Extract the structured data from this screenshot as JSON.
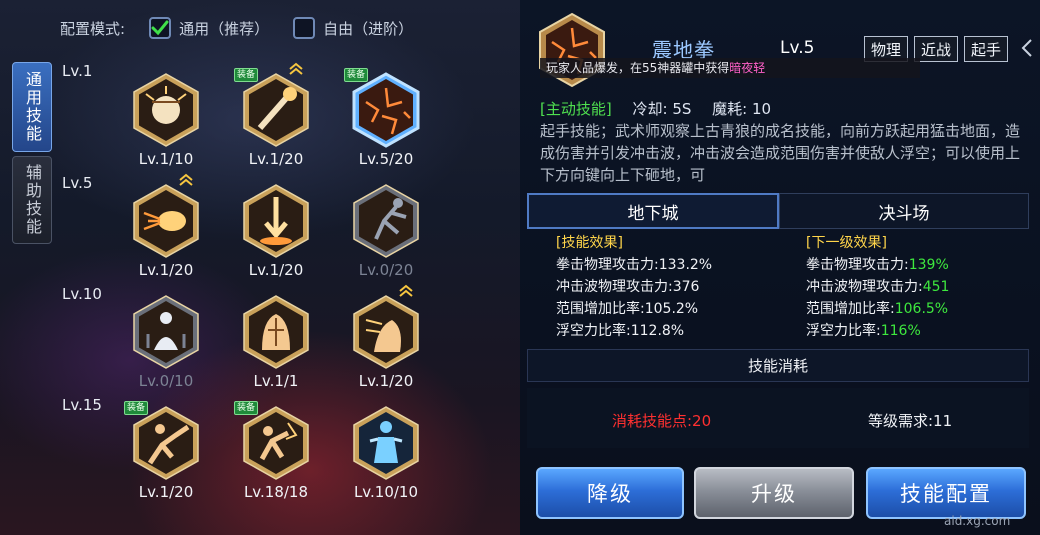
{
  "config": {
    "label": "配置模式:",
    "option_general": "通用（推荐）",
    "option_free": "自由（进阶）",
    "general_checked": true
  },
  "tabs": {
    "general": "通用技能",
    "support": "辅助技能"
  },
  "levels": [
    "Lv.1",
    "Lv.5",
    "Lv.10",
    "Lv.15"
  ],
  "skills": [
    {
      "level_text": "Lv.1/10",
      "icon": "fist-icon",
      "equipped": false,
      "upgradeable": false,
      "dim": false
    },
    {
      "level_text": "Lv.1/20",
      "icon": "hammer-punch-icon",
      "equipped": true,
      "upgradeable": true,
      "dim": false
    },
    {
      "level_text": "Lv.5/20",
      "icon": "earthquake-fist-icon",
      "equipped": true,
      "upgradeable": false,
      "dim": false
    },
    {
      "level_text": "Lv.1/20",
      "icon": "fireball-punch-icon",
      "equipped": false,
      "upgradeable": true,
      "dim": false
    },
    {
      "level_text": "Lv.1/20",
      "icon": "downward-strike-icon",
      "equipped": false,
      "upgradeable": false,
      "dim": false
    },
    {
      "level_text": "Lv.0/20",
      "icon": "fighter-stance-icon",
      "equipped": false,
      "upgradeable": false,
      "dim": true
    },
    {
      "level_text": "Lv.0/10",
      "icon": "meditation-icon",
      "equipped": false,
      "upgradeable": false,
      "dim": true
    },
    {
      "level_text": "Lv.1/1",
      "icon": "muscle-body-icon",
      "equipped": false,
      "upgradeable": false,
      "dim": false
    },
    {
      "level_text": "Lv.1/20",
      "icon": "back-strike-icon",
      "equipped": false,
      "upgradeable": true,
      "dim": false
    },
    {
      "level_text": "Lv.1/20",
      "icon": "flying-kick-icon",
      "equipped": true,
      "upgradeable": false,
      "dim": false
    },
    {
      "level_text": "Lv.18/18",
      "icon": "fury-punch-icon",
      "equipped": true,
      "upgradeable": false,
      "dim": false
    },
    {
      "level_text": "Lv.10/10",
      "icon": "spirit-body-icon",
      "equipped": false,
      "upgradeable": false,
      "dim": false
    }
  ],
  "badge_equipped": "装备",
  "detail": {
    "name": "震地拳",
    "level": "Lv.5",
    "tags": [
      "物理",
      "近战",
      "起手"
    ],
    "tooltip_text": "玩家人品爆发，在55神器罐中获得",
    "tooltip_highlight": "暗夜轻",
    "skill_type": "[主动技能]",
    "cooldown": "冷却:  5S",
    "mana": "魔耗:  10",
    "description": "起手技能；武术师观察上古青狼的成名技能，向前方跃起用猛击地面，造成伤害并引发冲击波，冲击波会造成范围伤害并使敌人浮空；可以使用上下方向键向上下砸地，可"
  },
  "mode_tabs": [
    "地下城",
    "决斗场"
  ],
  "current_effect": {
    "title": "[技能效果]",
    "lines": [
      "拳击物理攻击力:133.2%",
      "冲击波物理攻击力:376",
      "范围增加比率:105.2%",
      "浮空力比率:112.8%"
    ]
  },
  "next_effect": {
    "title": "[下一级效果]",
    "labels": [
      "拳击物理攻击力:",
      "冲击波物理攻击力:",
      "范围增加比率:",
      "浮空力比率:"
    ],
    "values": [
      "139%",
      "451",
      "106.5%",
      "116%"
    ]
  },
  "cost": {
    "title": "技能消耗",
    "skill_points": "消耗技能点:20",
    "level_req": "等级需求:11"
  },
  "buttons": {
    "downgrade": "降级",
    "upgrade": "升级",
    "config": "技能配置"
  },
  "watermark": "aid.xg.com"
}
